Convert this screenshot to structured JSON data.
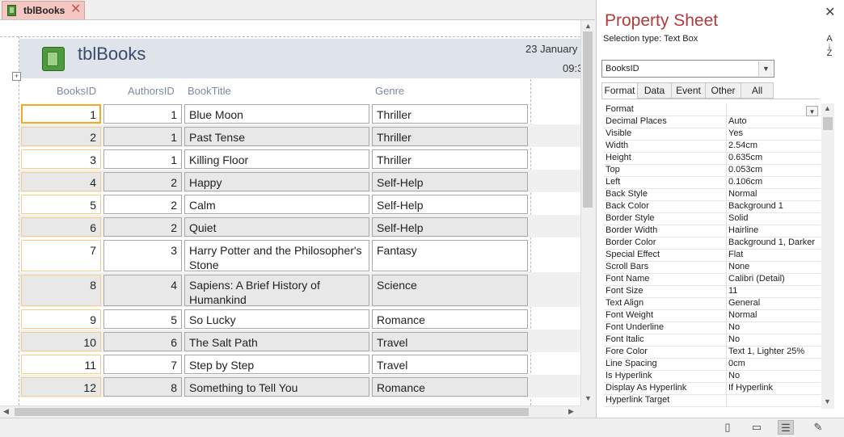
{
  "document_tab": {
    "label": "tblBooks",
    "close": "✕"
  },
  "form_header": {
    "title": "tblBooks",
    "date": "23 January",
    "time": "09:3"
  },
  "column_headers": {
    "books_id": "BooksID",
    "authors_id": "AuthorsID",
    "book_title": "BookTitle",
    "genre": "Genre"
  },
  "rows": [
    {
      "books_id": "1",
      "authors_id": "1",
      "book_title": "Blue Moon",
      "genre": "Thriller"
    },
    {
      "books_id": "2",
      "authors_id": "1",
      "book_title": "Past Tense",
      "genre": "Thriller"
    },
    {
      "books_id": "3",
      "authors_id": "1",
      "book_title": "Killing Floor",
      "genre": "Thriller"
    },
    {
      "books_id": "4",
      "authors_id": "2",
      "book_title": "Happy",
      "genre": "Self-Help"
    },
    {
      "books_id": "5",
      "authors_id": "2",
      "book_title": "Calm",
      "genre": "Self-Help"
    },
    {
      "books_id": "6",
      "authors_id": "2",
      "book_title": "Quiet",
      "genre": "Self-Help"
    },
    {
      "books_id": "7",
      "authors_id": "3",
      "book_title": "Harry Potter and the Philosopher's Stone",
      "genre": "Fantasy"
    },
    {
      "books_id": "8",
      "authors_id": "4",
      "book_title": "Sapiens: A Brief History of Humankind",
      "genre": "Science"
    },
    {
      "books_id": "9",
      "authors_id": "5",
      "book_title": "So Lucky",
      "genre": "Romance"
    },
    {
      "books_id": "10",
      "authors_id": "6",
      "book_title": "The Salt Path",
      "genre": "Travel"
    },
    {
      "books_id": "11",
      "authors_id": "7",
      "book_title": "Step by Step",
      "genre": "Travel"
    },
    {
      "books_id": "12",
      "authors_id": "8",
      "book_title": "Something to Tell You",
      "genre": "Romance"
    }
  ],
  "property_sheet": {
    "title": "Property Sheet",
    "selection_type": "Selection type:  Text Box",
    "selected_object": "BooksID",
    "tabs": [
      "Format",
      "Data",
      "Event",
      "Other",
      "All"
    ],
    "active_tab": "Format",
    "properties": [
      {
        "name": "Format",
        "value": ""
      },
      {
        "name": "Decimal Places",
        "value": "Auto"
      },
      {
        "name": "Visible",
        "value": "Yes"
      },
      {
        "name": "Width",
        "value": "2.54cm"
      },
      {
        "name": "Height",
        "value": "0.635cm"
      },
      {
        "name": "Top",
        "value": "0.053cm"
      },
      {
        "name": "Left",
        "value": "0.106cm"
      },
      {
        "name": "Back Style",
        "value": "Normal"
      },
      {
        "name": "Back Color",
        "value": "Background 1"
      },
      {
        "name": "Border Style",
        "value": "Solid"
      },
      {
        "name": "Border Width",
        "value": "Hairline"
      },
      {
        "name": "Border Color",
        "value": "Background 1, Darker"
      },
      {
        "name": "Special Effect",
        "value": "Flat"
      },
      {
        "name": "Scroll Bars",
        "value": "None"
      },
      {
        "name": "Font Name",
        "value": "Calibri (Detail)"
      },
      {
        "name": "Font Size",
        "value": "11"
      },
      {
        "name": "Text Align",
        "value": "General"
      },
      {
        "name": "Font Weight",
        "value": "Normal"
      },
      {
        "name": "Font Underline",
        "value": "No"
      },
      {
        "name": "Font Italic",
        "value": "No"
      },
      {
        "name": "Fore Color",
        "value": "Text 1, Lighter 25%"
      },
      {
        "name": "Line Spacing",
        "value": "0cm"
      },
      {
        "name": "Is Hyperlink",
        "value": "No"
      },
      {
        "name": "Display As Hyperlink",
        "value": "If Hyperlink"
      },
      {
        "name": "Hyperlink Target",
        "value": ""
      }
    ]
  },
  "icons": {
    "sort": "A↓Z",
    "close": "✕",
    "views": [
      "form-view-icon",
      "layout-view-icon",
      "design-view-icon",
      "property-view-icon"
    ]
  },
  "colors": {
    "accent_tab": "#f4c7c3",
    "focus_border": "#f5a623",
    "property_title": "#b23a3a"
  }
}
